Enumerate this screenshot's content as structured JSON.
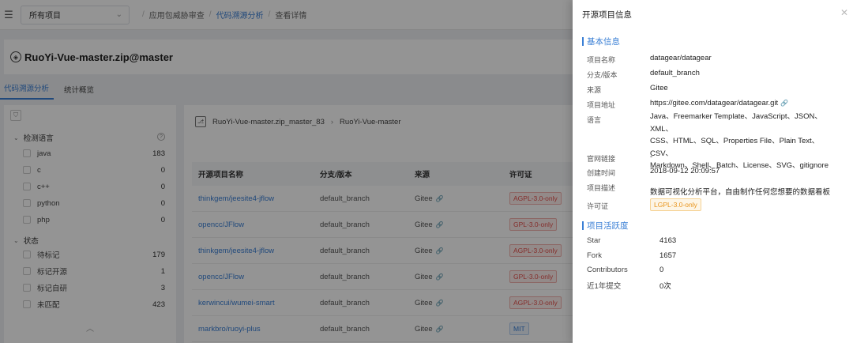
{
  "topbar": {
    "project_select": "所有项目",
    "breadcrumb": [
      "应用包威胁审查",
      "代码溯源分析",
      "查看详情"
    ]
  },
  "project": {
    "title": "RuoYi-Vue-master.zip@master"
  },
  "tabs": [
    {
      "label": "代码溯源分析",
      "active": true
    },
    {
      "label": "统计概览",
      "active": false
    }
  ],
  "filters": {
    "language": {
      "title": "检测语言",
      "items": [
        {
          "label": "java",
          "count": "183"
        },
        {
          "label": "c",
          "count": "0"
        },
        {
          "label": "c++",
          "count": "0"
        },
        {
          "label": "python",
          "count": "0"
        },
        {
          "label": "php",
          "count": "0"
        }
      ]
    },
    "status": {
      "title": "状态",
      "items": [
        {
          "label": "待标记",
          "count": "179"
        },
        {
          "label": "标记开源",
          "count": "1"
        },
        {
          "label": "标记自研",
          "count": "3"
        },
        {
          "label": "未匹配",
          "count": "423"
        }
      ]
    }
  },
  "path": {
    "root": "RuoYi-Vue-master.zip_master_83",
    "leaf": "RuoYi-Vue-master"
  },
  "table": {
    "headers": [
      "开源项目名称",
      "分支/版本",
      "来源",
      "许可证"
    ],
    "rows": [
      {
        "name": "thinkgem/jeesite4-jflow",
        "branch": "default_branch",
        "source": "Gitee",
        "license": "AGPL-3.0-only",
        "color": "red"
      },
      {
        "name": "opencc/JFlow",
        "branch": "default_branch",
        "source": "Gitee",
        "license": "GPL-3.0-only",
        "color": "red"
      },
      {
        "name": "thinkgem/jeesite4-jflow",
        "branch": "default_branch",
        "source": "Gitee",
        "license": "AGPL-3.0-only",
        "color": "red"
      },
      {
        "name": "opencc/JFlow",
        "branch": "default_branch",
        "source": "Gitee",
        "license": "GPL-3.0-only",
        "color": "red"
      },
      {
        "name": "kerwincui/wumei-smart",
        "branch": "default_branch",
        "source": "Gitee",
        "license": "AGPL-3.0-only",
        "color": "red"
      },
      {
        "name": "markbro/ruoyi-plus",
        "branch": "default_branch",
        "source": "Gitee",
        "license": "MIT",
        "color": "blue"
      }
    ]
  },
  "drawer": {
    "title": "开源项目信息",
    "basic_title": "基本信息",
    "fields": {
      "name_label": "项目名称",
      "name": "datagear/datagear",
      "branch_label": "分支/版本",
      "branch": "default_branch",
      "source_label": "来源",
      "source": "Gitee",
      "url_label": "项目地址",
      "url": "https://gitee.com/datagear/datagear.git",
      "lang_label": "语言",
      "lang_lines": [
        "Java、Freemarker Template、JavaScript、JSON、XML、",
        "CSS、HTML、SQL、Properties File、Plain Text、CSV、",
        "Markdown、Shell、Batch、License、SVG、gitignore"
      ],
      "site_label": "官网链接",
      "site": "-",
      "created_label": "创建时间",
      "created": "2018-09-12 20:09:57",
      "desc_label": "项目描述",
      "desc": "数据可视化分析平台，自由制作任何您想要的数据看板",
      "license_label": "许可证",
      "license": "LGPL-3.0-only"
    },
    "activity_title": "项目活跃度",
    "activity": [
      {
        "label": "Star",
        "value": "4163"
      },
      {
        "label": "Fork",
        "value": "1657"
      },
      {
        "label": "Contributors",
        "value": "0"
      },
      {
        "label": "近1年提交",
        "value": "0次"
      }
    ]
  }
}
